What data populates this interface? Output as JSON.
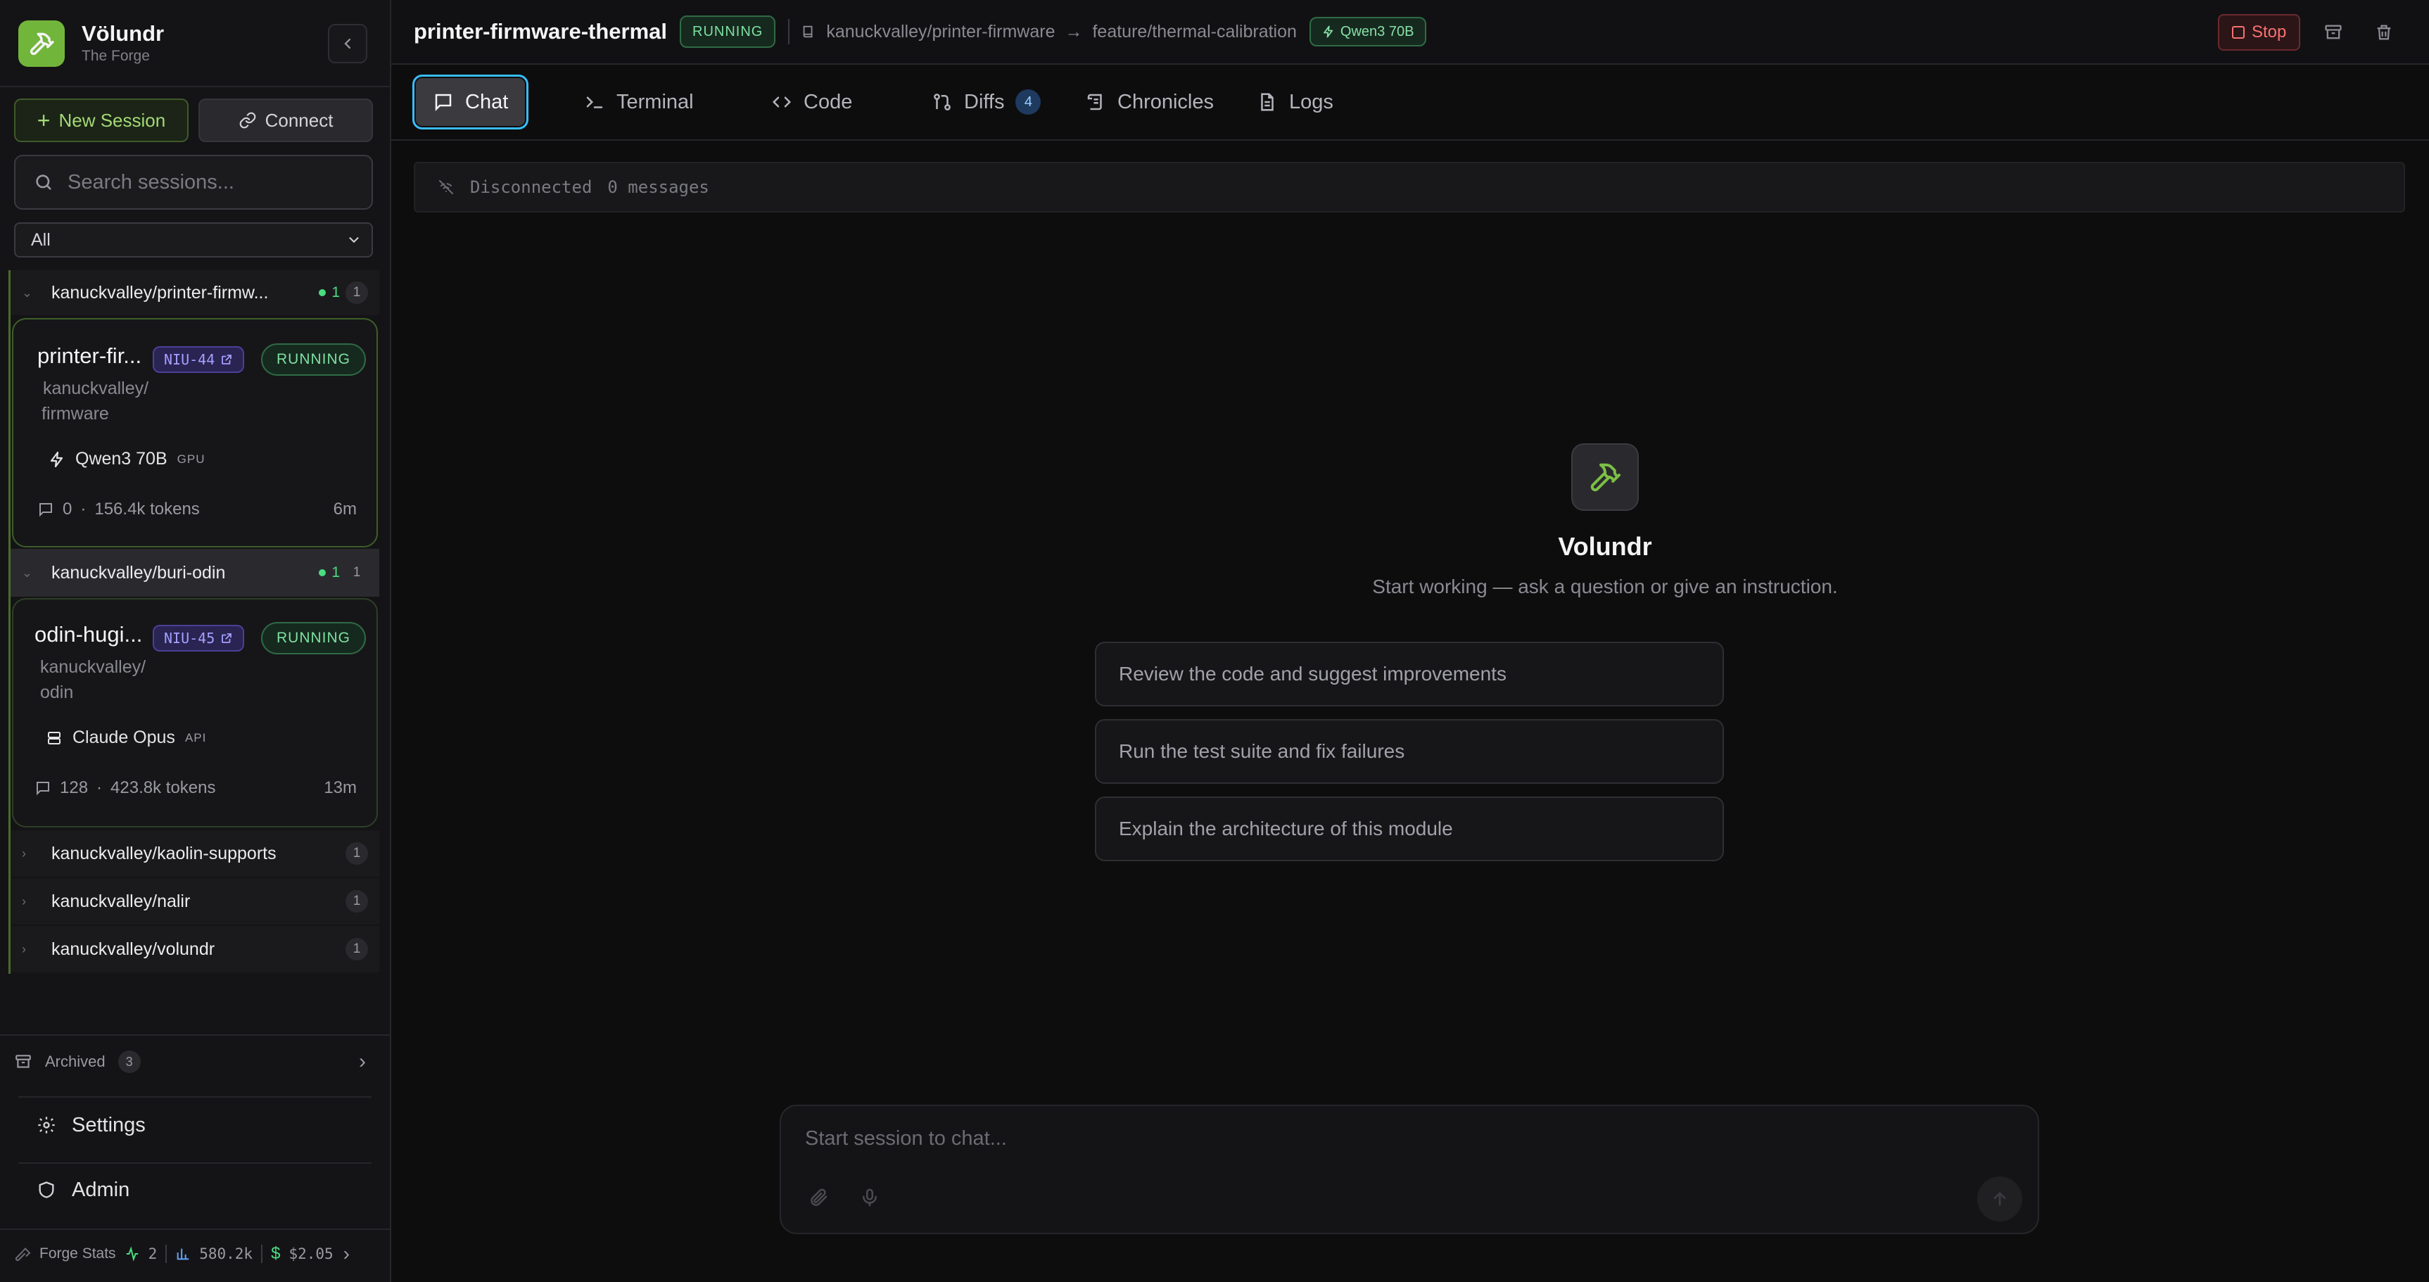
{
  "brand": {
    "name": "Völundr",
    "subtitle": "The Forge"
  },
  "sidebar": {
    "new_session_label": "New Session",
    "connect_label": "Connect",
    "search_placeholder": "Search sessions...",
    "filter_value": "All",
    "groups": [
      {
        "name": "kanuckvalley/printer-firmw...",
        "active_count": "1",
        "count": "1",
        "session": {
          "title": "printer-fir...",
          "ticket": "NIU-44",
          "status": "RUNNING",
          "path_line1": "kanuckvalley/",
          "path_line2": "firmware",
          "model": "Qwen3 70B",
          "model_kind": "GPU",
          "messages": "0",
          "tokens": "156.4k tokens",
          "age": "6m"
        }
      },
      {
        "name": "kanuckvalley/buri-odin",
        "active_count": "1",
        "count": "1",
        "session": {
          "title": "odin-hugi...",
          "ticket": "NIU-45",
          "status": "RUNNING",
          "path_line1": "kanuckvalley/",
          "path_line2": "odin",
          "model": "Claude Opus",
          "model_kind": "API",
          "messages": "128",
          "tokens": "423.8k tokens",
          "age": "13m"
        }
      },
      {
        "name": "kanuckvalley/kaolin-supports",
        "count": "1"
      },
      {
        "name": "kanuckvalley/nalir",
        "count": "1"
      },
      {
        "name": "kanuckvalley/volundr",
        "count": "1"
      }
    ],
    "archived_label": "Archived",
    "archived_count": "3",
    "settings_label": "Settings",
    "admin_label": "Admin",
    "stats": {
      "label": "Forge Stats",
      "active": "2",
      "tokens": "580.2k",
      "cost": "$2.05"
    }
  },
  "topbar": {
    "title": "printer-firmware-thermal",
    "status": "RUNNING",
    "repo": "kanuckvalley/printer-firmware",
    "branch": "feature/thermal-calibration",
    "model": "Qwen3 70B",
    "stop_label": "Stop"
  },
  "tabs": [
    {
      "label": "Chat"
    },
    {
      "label": "Terminal"
    },
    {
      "label": "Code"
    },
    {
      "label": "Diffs",
      "badge": "4"
    },
    {
      "label": "Chronicles"
    },
    {
      "label": "Logs"
    }
  ],
  "chat": {
    "connection": "Disconnected",
    "messages": "0 messages",
    "empty_title": "Volundr",
    "empty_subtitle": "Start working — ask a question or give an instruction.",
    "suggestions": [
      "Review the code and suggest improvements",
      "Run the test suite and fix failures",
      "Explain the architecture of this module"
    ],
    "composer_placeholder": "Start session to chat..."
  },
  "colors": {
    "accent": "#72b53b",
    "running": "#7ee0a0",
    "stop": "#f87171",
    "focus": "#38bdf8"
  }
}
